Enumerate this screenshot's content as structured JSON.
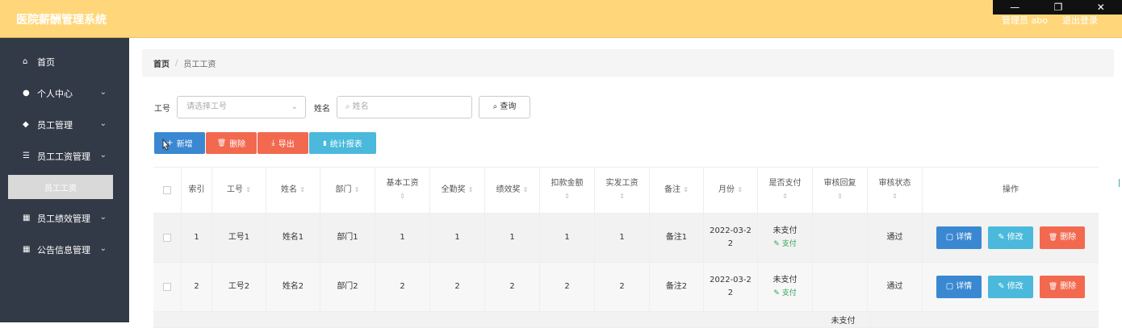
{
  "header": {
    "app_title": "医院薪酬管理系统",
    "user_label": "管理员 abo",
    "logout_label": "退出登录",
    "window_controls": [
      "—",
      "❐",
      "✕"
    ]
  },
  "sidebar": {
    "items": [
      {
        "label": "首页",
        "icon": "home-icon",
        "glyph": "⌂",
        "has_chevron": false
      },
      {
        "label": "个人中心",
        "icon": "user-icon",
        "glyph": "●",
        "has_chevron": true
      },
      {
        "label": "员工管理",
        "icon": "location-icon",
        "glyph": "◆",
        "has_chevron": true
      },
      {
        "label": "员工工资管理",
        "icon": "list-icon",
        "glyph": "☰",
        "has_chevron": true
      },
      {
        "label": "员工工资",
        "active_sub": true
      },
      {
        "label": "员工绩效管理",
        "icon": "grid-icon",
        "glyph": "▦",
        "has_chevron": true
      },
      {
        "label": "公告信息管理",
        "icon": "grid-icon",
        "glyph": "▦",
        "has_chevron": true
      }
    ],
    "chevron": "⌄"
  },
  "breadcrumb": {
    "home": "首页",
    "separator": "/",
    "current": "员工工资"
  },
  "search": {
    "gonghao_label": "工号",
    "gonghao_placeholder": "请选择工号",
    "xingming_label": "姓名",
    "xingming_placeholder": "姓名",
    "query_label": "查询",
    "search_glyph": "⌕"
  },
  "toolbar": {
    "add": {
      "label": "新增",
      "glyph": "+",
      "color": "#3a88d2"
    },
    "delete": {
      "label": "删除",
      "glyph": "🗑",
      "color": "#f2694f"
    },
    "export": {
      "label": "导出",
      "glyph": "⤓",
      "color": "#f2694f"
    },
    "stats": {
      "label": "统计报表",
      "glyph": "▮",
      "color": "#4ab9dc"
    }
  },
  "table": {
    "sort_glyph": "⇕",
    "headers": [
      "索引",
      "工号",
      "姓名",
      "部门",
      "基本工资",
      "全勤奖",
      "绩效奖",
      "扣款金额",
      "实发工资",
      "备注",
      "月份",
      "是否支付",
      "审核回复",
      "审核状态",
      "操作"
    ],
    "rows": [
      {
        "index": "1",
        "gonghao": "工号1",
        "xingming": "姓名1",
        "bumen": "部门1",
        "jiben": "1",
        "quanqin": "1",
        "jixiao": "1",
        "koukuan": "1",
        "shifa": "1",
        "beizhu": "备注1",
        "yuefen": "2022-03-2\n2",
        "zhifu": "未支付",
        "pay_action": "支付",
        "huifu": "",
        "zhuangtai": "通过"
      },
      {
        "index": "2",
        "gonghao": "工号2",
        "xingming": "姓名2",
        "bumen": "部门2",
        "jiben": "2",
        "quanqin": "2",
        "jixiao": "2",
        "koukuan": "2",
        "shifa": "2",
        "beizhu": "备注2",
        "yuefen": "2022-03-2\n2",
        "zhifu": "未支付",
        "pay_action": "支付",
        "huifu": "",
        "zhuangtai": "通过"
      }
    ],
    "ops": {
      "detail": {
        "label": "详情",
        "glyph": "▢",
        "color": "#3a88d2"
      },
      "edit": {
        "label": "修改",
        "glyph": "✎",
        "color": "#4ab9dc"
      },
      "delete": {
        "label": "删除",
        "glyph": "🗑",
        "color": "#f2694f"
      }
    },
    "partial_row_text": "未支付"
  }
}
